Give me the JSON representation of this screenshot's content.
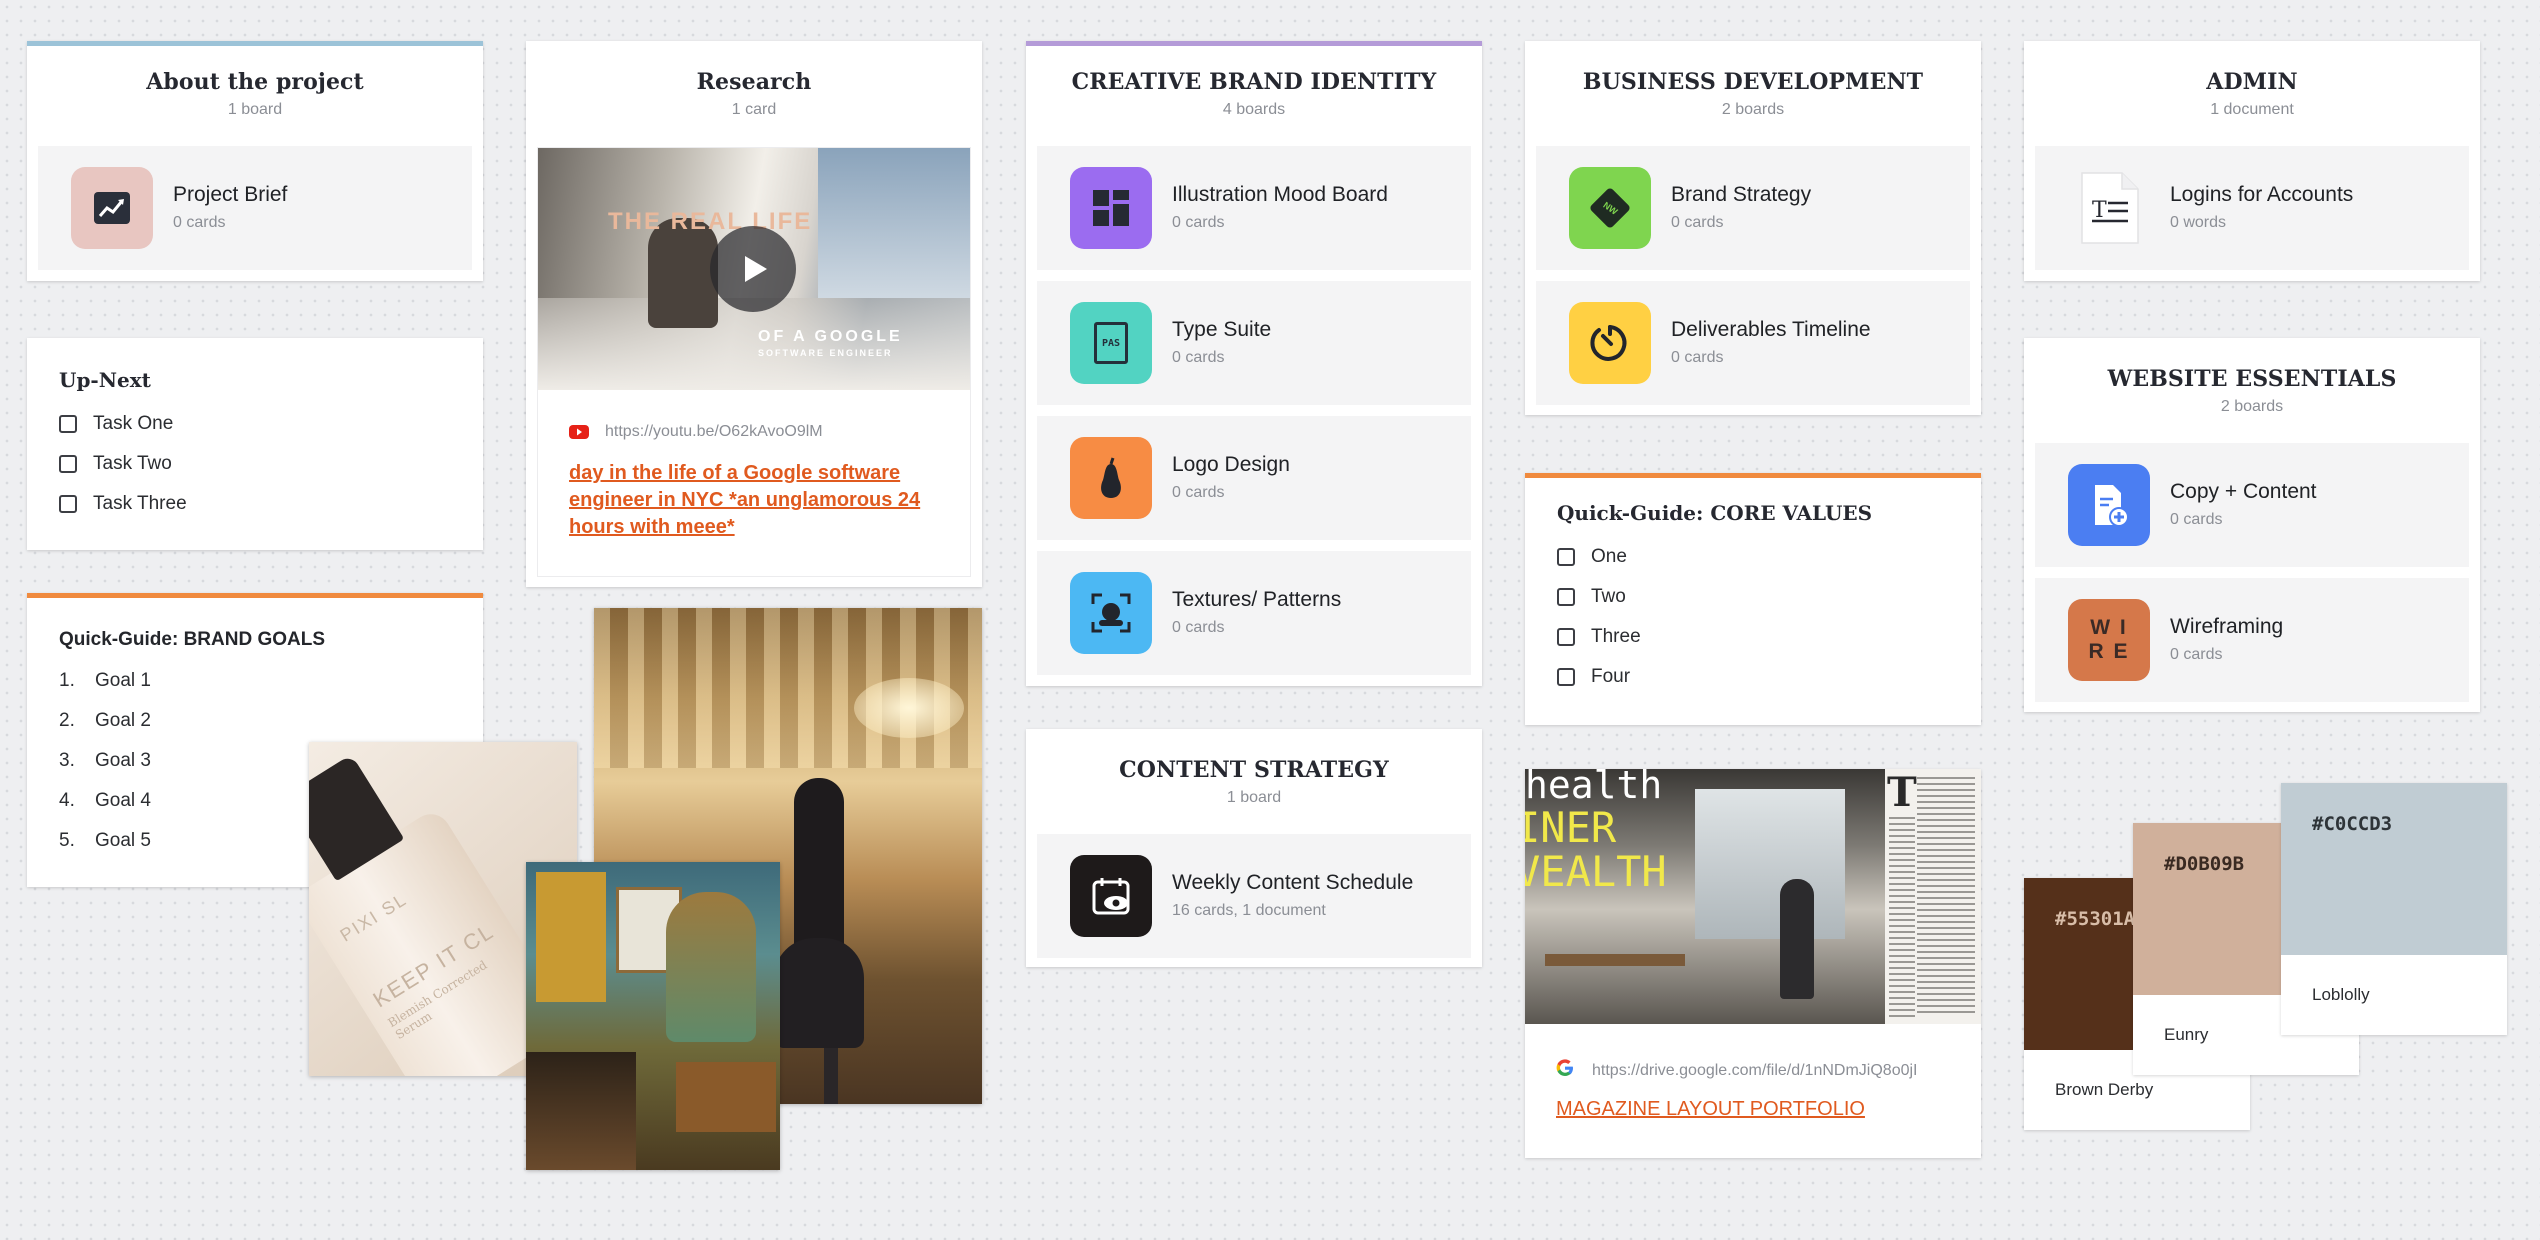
{
  "about": {
    "title": "About the project",
    "count": "1 board",
    "boards": [
      {
        "title": "Project Brief",
        "meta": "0 cards"
      }
    ]
  },
  "upnext": {
    "title": "Up-Next",
    "tasks": [
      "Task One",
      "Task Two",
      "Task Three"
    ]
  },
  "brand_goals": {
    "title": "Quick-Guide: BRAND GOALS",
    "items": [
      {
        "n": "1.",
        "t": "Goal 1"
      },
      {
        "n": "2.",
        "t": "Goal 2"
      },
      {
        "n": "3.",
        "t": "Goal 3"
      },
      {
        "n": "4.",
        "t": "Goal 4"
      },
      {
        "n": "5.",
        "t": "Goal 5"
      }
    ]
  },
  "research": {
    "title": "Research",
    "count": "1 card",
    "video": {
      "overlay_top": "THE REAL LIFE",
      "overlay_bottom": "OF A GOOGLE",
      "overlay_sub": "SOFTWARE ENGINEER"
    },
    "url": "https://youtu.be/O62kAvoO9lM",
    "link": "day in the life of a Google software engineer in NYC *an unglamorous 24 hours with meee*"
  },
  "serum": {
    "line1": "KEEP IT CL",
    "line2": "Blemish Corrected Serum",
    "brand": "PIXI SL"
  },
  "creative": {
    "title": "CREATIVE BRAND IDENTITY",
    "count": "4 boards",
    "boards": [
      {
        "title": "Illustration Mood Board",
        "meta": "0 cards"
      },
      {
        "title": "Type Suite",
        "meta": "0 cards",
        "icon_text": "PAS"
      },
      {
        "title": "Logo Design",
        "meta": "0 cards"
      },
      {
        "title": "Textures/ Patterns",
        "meta": "0 cards"
      }
    ]
  },
  "content": {
    "title": "CONTENT STRATEGY",
    "count": "1 board",
    "boards": [
      {
        "title": "Weekly Content Schedule",
        "meta": "16 cards, 1 document"
      }
    ]
  },
  "bizdev": {
    "title": "BUSINESS DEVELOPMENT",
    "count": "2 boards",
    "boards": [
      {
        "title": "Brand Strategy",
        "meta": "0 cards",
        "icon_text": "NW"
      },
      {
        "title": "Deliverables Timeline",
        "meta": "0 cards"
      }
    ]
  },
  "core_values": {
    "title": "Quick-Guide: CORE VALUES",
    "items": [
      "One",
      "Two",
      "Three",
      "Four"
    ]
  },
  "magazine": {
    "headline1": "health",
    "headline2": "INER",
    "headline3": "VEALTH",
    "dropcap": "T",
    "url": "https://drive.google.com/file/d/1nNDmJiQ8o0jI",
    "link": "MAGAZINE LAYOUT PORTFOLIO"
  },
  "admin": {
    "title": "ADMIN",
    "count": "1 document",
    "boards": [
      {
        "title": "Logins for Accounts",
        "meta": "0 words"
      }
    ]
  },
  "website": {
    "title": "WEBSITE ESSENTIALS",
    "count": "2 boards",
    "boards": [
      {
        "title": "Copy + Content",
        "meta": "0 cards"
      },
      {
        "title": "Wireframing",
        "meta": "0 cards",
        "icon_text1": "W I",
        "icon_text2": "R E"
      }
    ]
  },
  "swatches": [
    {
      "hex": "#55301A",
      "name": "Brown Derby",
      "color": "#55301a"
    },
    {
      "hex": "#D0B09B",
      "name": "Eunry",
      "color": "#d0b09b"
    },
    {
      "hex": "#C0CCD3",
      "name": "Loblolly",
      "color": "#c0ccd3"
    }
  ],
  "colors": {
    "about_bar": "#9cc3d8",
    "creative_bar": "#b49bd8",
    "orange_bar": "#f08a3e",
    "link_orange": "#e05a1f",
    "purple": "#9b6cf0",
    "teal": "#52d3c2",
    "orange": "#f78c44",
    "blue": "#4cb8f3",
    "green": "#7fd54f",
    "yellow": "#ffd043",
    "royal": "#4b7ef2",
    "terra": "#d5784a"
  }
}
